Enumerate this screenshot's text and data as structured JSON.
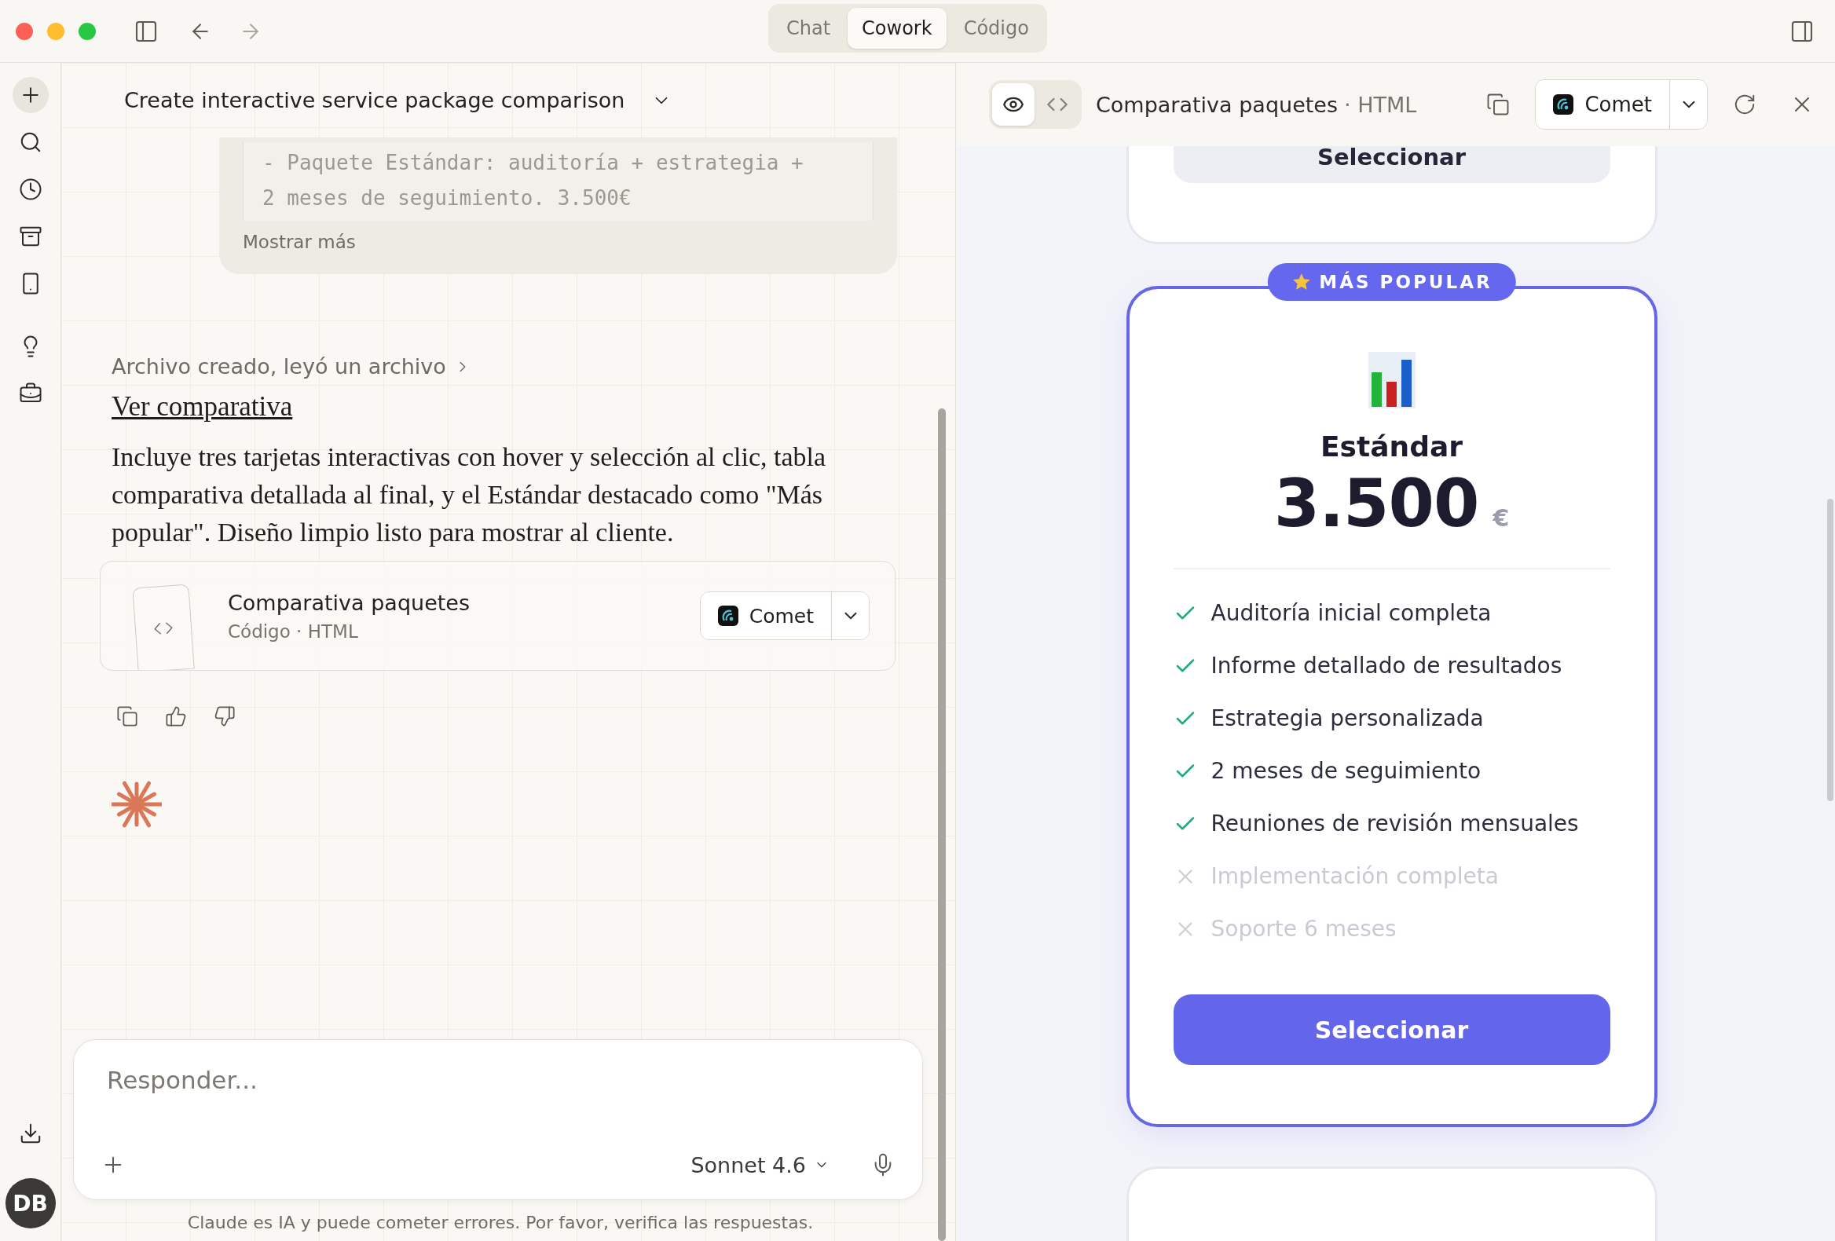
{
  "window": {
    "tabs": [
      {
        "label": "Chat",
        "selected": false
      },
      {
        "label": "Cowork",
        "selected": true
      },
      {
        "label": "Código",
        "selected": false
      }
    ]
  },
  "conversation": {
    "title": "Create interactive service package comparison",
    "quoted_code_lines": [
      "- Paquete Estándar: auditoría + estrategia +",
      "2 meses de seguimiento. 3.500€"
    ],
    "show_more": "Mostrar más",
    "activity": "Archivo creado, leyó un archivo",
    "link": "Ver comparativa",
    "message": "Incluye tres tarjetas interactivas con hover y selección al clic, tabla comparativa detallada al final, y el Estándar destacado como \"Más popular\". Diseño limpio listo para mostrar al cliente.",
    "artifact": {
      "title": "Comparativa paquetes",
      "subtitle": "Código · HTML",
      "open_with": "Comet"
    }
  },
  "composer": {
    "placeholder": "Responder...",
    "model": "Sonnet 4.6"
  },
  "disclaimer": "Claude es IA y puede cometer errores. Por favor, verifica las respuestas.",
  "avatar": "DB",
  "preview": {
    "view_modes": [
      {
        "kind": "preview",
        "selected": true
      },
      {
        "kind": "code",
        "selected": false
      }
    ],
    "title": "Comparativa paquetes",
    "title_suffix": "· HTML",
    "open_with": "Comet",
    "previous_card_button": "Seleccionar",
    "featured_card": {
      "badge": "MÁS POPULAR",
      "name": "Estándar",
      "price": "3.500",
      "currency": "€",
      "features": [
        {
          "text": "Auditoría inicial completa",
          "included": true
        },
        {
          "text": "Informe detallado de resultados",
          "included": true
        },
        {
          "text": "Estrategia personalizada",
          "included": true
        },
        {
          "text": "2 meses de seguimiento",
          "included": true
        },
        {
          "text": "Reuniones de revisión mensuales",
          "included": true
        },
        {
          "text": "Implementación completa",
          "included": false
        },
        {
          "text": "Soporte 6 meses",
          "included": false
        }
      ],
      "button": "Seleccionar"
    }
  }
}
